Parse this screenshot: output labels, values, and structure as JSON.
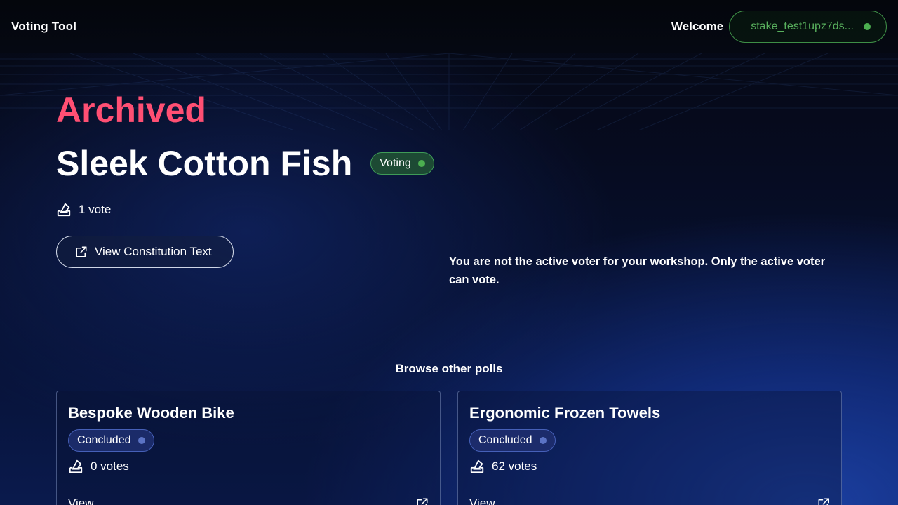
{
  "header": {
    "brand": "Voting Tool",
    "welcome": "Welcome",
    "wallet_address": "stake_test1upz7ds..."
  },
  "poll": {
    "status_heading": "Archived",
    "title": "Sleek Cotton Fish",
    "badge": "Voting",
    "votes": "1 vote",
    "constitution_button": "View Constitution Text",
    "notice": "You are not the active voter for your workshop. Only the active voter can vote."
  },
  "browse": {
    "heading": "Browse other polls",
    "cards": [
      {
        "title": "Bespoke Wooden Bike",
        "badge": "Concluded",
        "votes": "0 votes",
        "link": "View"
      },
      {
        "title": "Ergonomic Frozen Towels",
        "badge": "Concluded",
        "votes": "62 votes",
        "link": "View"
      }
    ]
  },
  "colors": {
    "archived": "#ff4f73",
    "voting_green": "#4caf50",
    "concluded_blue": "#5b73c4",
    "wallet_green": "#58b05d"
  },
  "icons": {
    "ballot": "ballot-box-icon",
    "external": "external-link-icon",
    "status": "status-dot-icon"
  }
}
